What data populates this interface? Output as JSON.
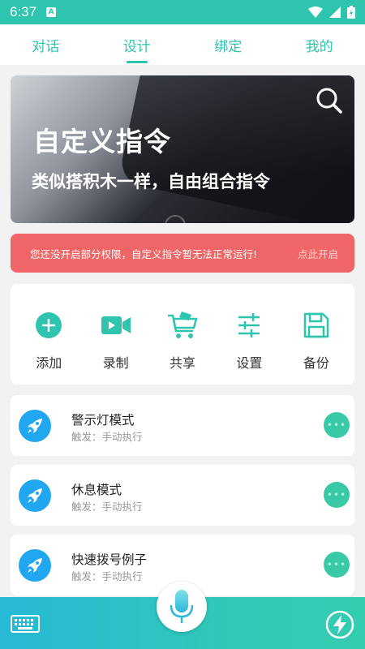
{
  "status_bar": {
    "time": "6:37",
    "notif_icon": "a-icon"
  },
  "tabs": [
    {
      "label": "对话",
      "active": false
    },
    {
      "label": "设计",
      "active": true
    },
    {
      "label": "绑定",
      "active": false
    },
    {
      "label": "我的",
      "active": false
    }
  ],
  "banner": {
    "title": "自定义指令",
    "subtitle": "类似搭积木一样，自由组合指令"
  },
  "alert": {
    "message": "您还没开启部分权限，自定义指令暂无法正常运行!",
    "action": "点此开启"
  },
  "tools": [
    {
      "label": "添加",
      "icon": "plus-circle-icon"
    },
    {
      "label": "录制",
      "icon": "video-icon"
    },
    {
      "label": "共享",
      "icon": "cart-icon"
    },
    {
      "label": "设置",
      "icon": "sliders-icon"
    },
    {
      "label": "备份",
      "icon": "save-icon"
    }
  ],
  "commands": [
    {
      "name": "警示灯模式",
      "trigger": "触发：手动执行"
    },
    {
      "name": "休息模式",
      "trigger": "触发：手动执行"
    },
    {
      "name": "快速拨号例子",
      "trigger": "触发：手动执行"
    }
  ],
  "colors": {
    "accent": "#2ec4ad",
    "alert": "#f06666",
    "command_icon": "#21a7f0"
  }
}
